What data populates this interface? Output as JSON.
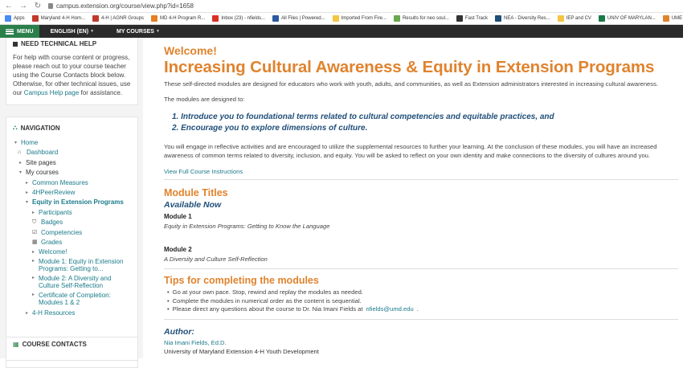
{
  "browser": {
    "url": "campus.extension.org/course/view.php?id=1658",
    "bookmarks": [
      {
        "label": "Apps",
        "color": "#4a8af4"
      },
      {
        "label": "Maryland 4-H Hom...",
        "color": "#c0392b"
      },
      {
        "label": "4-H | AGNR Groups",
        "color": "#c0392b"
      },
      {
        "label": "MD 4-H Program R...",
        "color": "#e67e22"
      },
      {
        "label": "Inbox (23) - nfields...",
        "color": "#d93025"
      },
      {
        "label": "All Files | Powered...",
        "color": "#2c5aa0"
      },
      {
        "label": "Imported From Fire...",
        "color": "#f4c542"
      },
      {
        "label": "Results for neo soul...",
        "color": "#6aa84f"
      },
      {
        "label": "Fast Track",
        "color": "#333333"
      },
      {
        "label": "NEA - Diversity Res...",
        "color": "#1f4e79"
      },
      {
        "label": "IEP and CV",
        "color": "#f4c542"
      },
      {
        "label": "UNIV OF MARYLAN...",
        "color": "#1a7a4a"
      },
      {
        "label": "UME Qualtrics",
        "color": "#e0832e"
      }
    ]
  },
  "topbar": {
    "menu_label": "MENU",
    "language_label": "ENGLISH (EN)",
    "courses_label": "MY COURSES",
    "accent": "#2a7f4a"
  },
  "sidebar": {
    "help_title": "NEED TECHNICAL HELP",
    "help_text": "For help with course content or progress, please reach out to your course teacher using the Course Contacts block below. Otherwise, for other technical issues, use our",
    "help_link": "Campus Help page",
    "help_suffix": "for assistance.",
    "nav_title": "NAVIGATION",
    "nav": {
      "home": "Home",
      "dashboard": "Dashboard",
      "site_pages": "Site pages",
      "my_courses": "My courses",
      "common_measures": "Common Measures",
      "peer_review": "4HPeerReview",
      "equity": "Equity in Extension Programs",
      "participants": "Participants",
      "badges": "Badges",
      "competencies": "Competencies",
      "grades": "Grades",
      "welcome": "Welcome!",
      "module1": "Module 1: Equity in Extension Programs: Getting to...",
      "module2": "Module 2: A Diversity and Culture Self-Reflection",
      "certificate": "Certificate of Completion: Modules 1 & 2",
      "resources": "4-H Resources"
    },
    "contacts_title": "COURSE CONTACTS"
  },
  "main": {
    "welcome": "Welcome!",
    "title": "Increasing Cultural Awareness & Equity in Extension Programs",
    "intro": "These self-directed modules are designed for educators who work with youth, adults, and communities, as well as Extension administrators interested in increasing cultural awareness.",
    "designed_to": "The modules are designed to:",
    "goal1": "1. Introduce you to foundational terms related to cultural competencies and equitable practices, and",
    "goal2": "2. Encourage you to explore dimensions of culture.",
    "engage": "You will engage in reflective activities and are encouraged to utilize the supplemental resources to further your learning. At the conclusion of these modules, you will have an increased awareness of common terms related to diversity, inclusion, and equity. You will be asked to reflect on your own identity and make connections to the diversity of cultures around you.",
    "instructions_link": "View Full Course Instructions",
    "module_titles": "Module Titles",
    "available_now": "Available Now",
    "module1_label": "Module 1",
    "module1_desc": "Equity in Extension Programs: Getting to Know the Language",
    "module2_label": "Module 2",
    "module2_desc": "A Diversity and Culture Self-Reflection",
    "tips_title": "Tips for completing the modules",
    "tips": [
      "Go at your own pace. Stop, rewind and replay the modules as needed.",
      "Complete the modules in numerical order as the content is sequential.",
      "Please direct any questions about the course to Dr. Nia Imani Fields at"
    ],
    "tips_email": "nfields@umd.edu",
    "author_heading": "Author:",
    "author_name": "Nia Imani Fields, Ed.D.",
    "author_org": "University of Maryland Extension 4-H Youth Development",
    "orange": "#e0832e",
    "navy": "#1f4e79"
  }
}
